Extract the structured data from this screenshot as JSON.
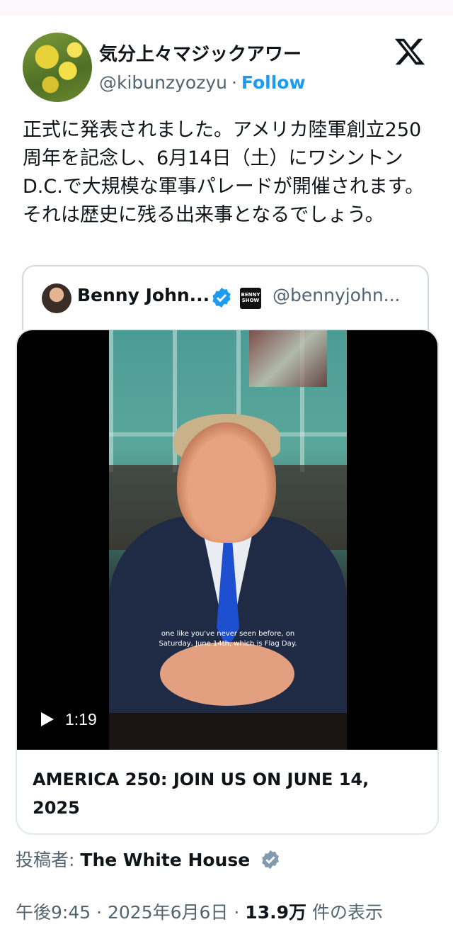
{
  "author": {
    "display_name": "気分上々マジックアワー",
    "handle": "@kibunzyozyu",
    "separator": "·",
    "follow_label": "Follow"
  },
  "tweet": {
    "text": "正式に発表されました。アメリカ陸軍創立250周年を記念し、6月14日（土）にワシントンD.C.で大規模な軍事パレードが開催されます。それは歴史に残る出来事となるでしょう。"
  },
  "quoted": {
    "name": "Benny John...",
    "badge_text": "BENNY SHOW",
    "handle": "@bennyjohn..."
  },
  "video": {
    "subtitle_line1": "one like you've never seen before, on",
    "subtitle_line2": "Saturday, June 14th, which is Flag Day.",
    "duration": "1:19",
    "title": "AMERICA 250: JOIN US ON JUNE 14, 2025"
  },
  "posted_by": {
    "label": "投稿者:",
    "name": "The White House"
  },
  "meta": {
    "time": "午後9:45",
    "sep1": "·",
    "date": "2025年6月6日",
    "sep2": "·",
    "views": "13.9万",
    "views_label": "件の表示"
  },
  "colors": {
    "accent": "#1d9bf0",
    "secondary_text": "#536471",
    "border": "#cfd9de",
    "verified_gray": "#829aab"
  }
}
